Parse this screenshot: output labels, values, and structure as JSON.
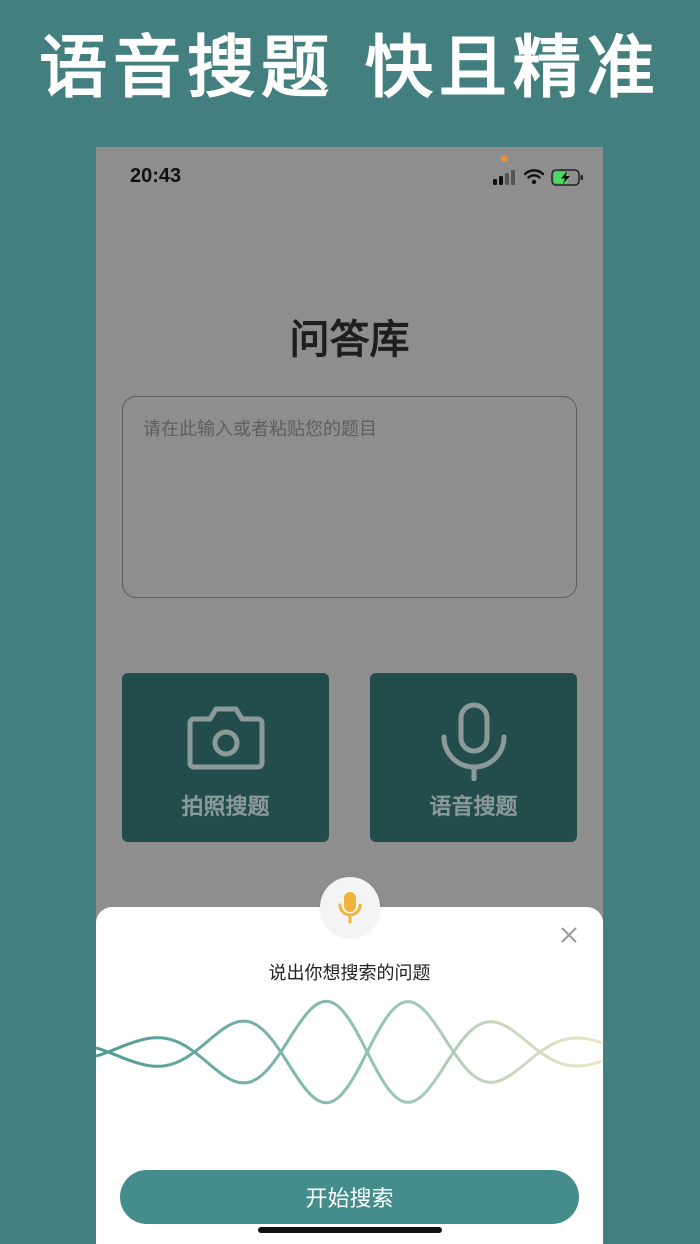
{
  "promo": {
    "headline": "语音搜题 快且精准"
  },
  "status_bar": {
    "time": "20:43",
    "icons": [
      "cellular-signal-icon",
      "wifi-icon",
      "battery-charging-icon"
    ]
  },
  "app": {
    "title": "问答库",
    "question_input": {
      "value": "",
      "placeholder": "请在此输入或者粘贴您的题目"
    },
    "actions": [
      {
        "label": "拍照搜题",
        "icon": "camera-icon"
      },
      {
        "label": "语音搜题",
        "icon": "microphone-icon"
      }
    ]
  },
  "voice_sheet": {
    "mic_icon": "microphone-icon",
    "close_icon": "close-icon",
    "prompt": "说出你想搜索的问题",
    "start_button": "开始搜索"
  },
  "colors": {
    "background": "#447f80",
    "dim_overlay": "#8e8e8e",
    "action_button": "#234d4d",
    "primary": "#448d8c",
    "mic_accent": "#f0b43c"
  }
}
